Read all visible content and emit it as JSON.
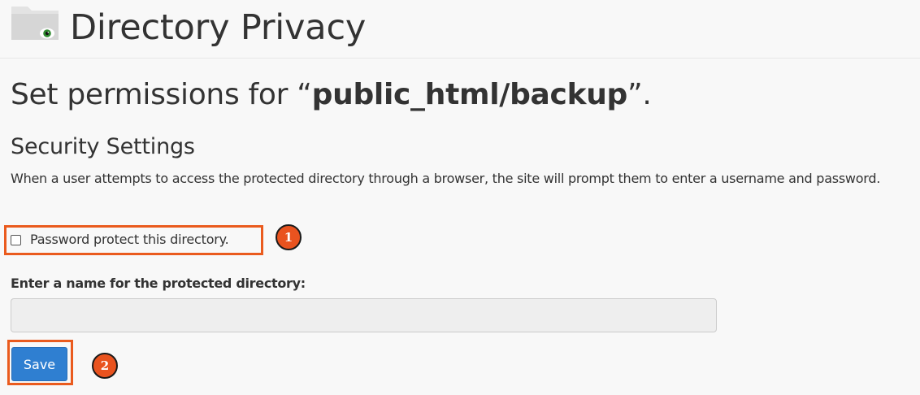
{
  "header": {
    "icon": "folder-eye-icon",
    "title": "Directory Privacy"
  },
  "permissions": {
    "prefix": "Set permissions for “",
    "directory": "public_html/backup",
    "suffix": "”."
  },
  "security": {
    "title": "Security Settings",
    "description": "When a user attempts to access the protected directory through a browser, the site will prompt them to enter a username and password."
  },
  "password_protect": {
    "label": "Password protect this directory.",
    "checked": false
  },
  "name_field": {
    "label": "Enter a name for the protected directory:",
    "value": "",
    "disabled": true
  },
  "actions": {
    "save_label": "Save"
  },
  "annotations": {
    "marker_1": "1",
    "marker_2": "2"
  },
  "colors": {
    "annotation": "#ea5b1e",
    "save_button": "#2f7fd1",
    "background": "#f8f8f8"
  }
}
